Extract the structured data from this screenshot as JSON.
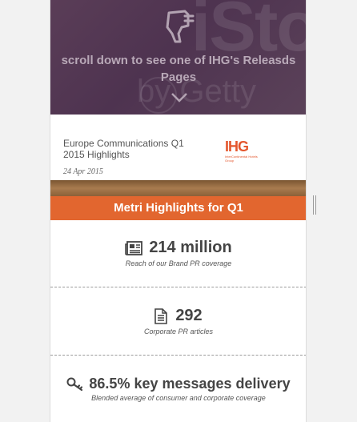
{
  "hero": {
    "scroll_hint": "scroll down to see one of IHG's Releasds Pages",
    "icons": [
      "pointing-hand-icon",
      "chevron-down-icon"
    ]
  },
  "release": {
    "title": "Europe Communications Q1 2015 Highlights",
    "date": "24 Apr 2015",
    "logo_text": "IHG",
    "logo_subtext": "InterContinental Hotels Group"
  },
  "section": {
    "header": "Metri Highlights for Q1"
  },
  "metrics": [
    {
      "icon": "newspaper-icon",
      "value": "214 million",
      "caption": "Reach of our Brand PR coverage"
    },
    {
      "icon": "document-icon",
      "value": "292",
      "caption": "Corporate PR articles"
    },
    {
      "icon": "key-icon",
      "value": "86.5% key messages delivery",
      "caption": "Blended average of consumer and corporate coverage"
    }
  ],
  "colors": {
    "accent": "#e2662f",
    "hero": "#53384f",
    "text": "#444444"
  }
}
